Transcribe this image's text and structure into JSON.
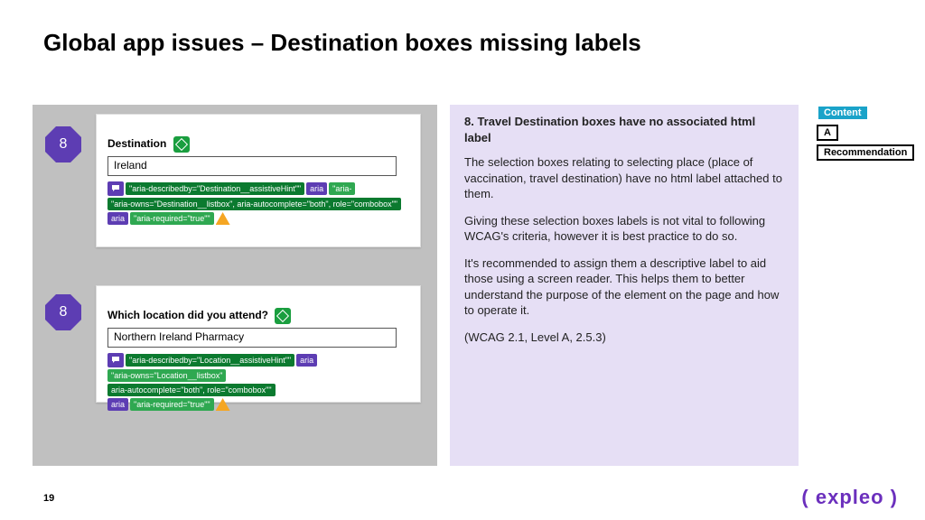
{
  "title": "Global app issues – Destination boxes missing labels",
  "pageNumber": "19",
  "logo": "expleo",
  "badges": {
    "content": "Content",
    "level": "A",
    "rec": "Recommendation"
  },
  "left": {
    "marker": "8",
    "block1": {
      "label": "Destination",
      "value": "Ireland",
      "attr1": "\"aria-describedby=\"Destination__assistiveHint\"\"",
      "aria": "aria",
      "attr2": "\"aria-owns=\"Destination__listbox\", aria-autocomplete=\"both\", role=\"combobox\"\"",
      "attr3": "\"aria-required=\"true\"\""
    },
    "block2": {
      "label": "Which location did you attend?",
      "value": "Northern Ireland Pharmacy",
      "attr1": "\"aria-describedby=\"Location__assistiveHint\"\"",
      "aria": "aria",
      "attr2": "\"aria-owns=\"Location__listbox\"",
      "attr2b": "aria-autocomplete=\"both\", role=\"combobox\"\"",
      "attr3": "\"aria-required=\"true\"\""
    }
  },
  "right": {
    "heading": "8. Travel Destination boxes have no associated html label",
    "p1": "The selection boxes relating to selecting place (place of vaccination, travel destination) have no html label attached to them.",
    "p2": "Giving these selection boxes labels is not vital to following WCAG's criteria, however it is best practice to do so.",
    "p3": "It's recommended to assign them a descriptive label to aid those using a screen reader. This helps them to better understand the purpose of the element on the page and how to operate it.",
    "p4": "(WCAG 2.1, Level A, 2.5.3)"
  }
}
